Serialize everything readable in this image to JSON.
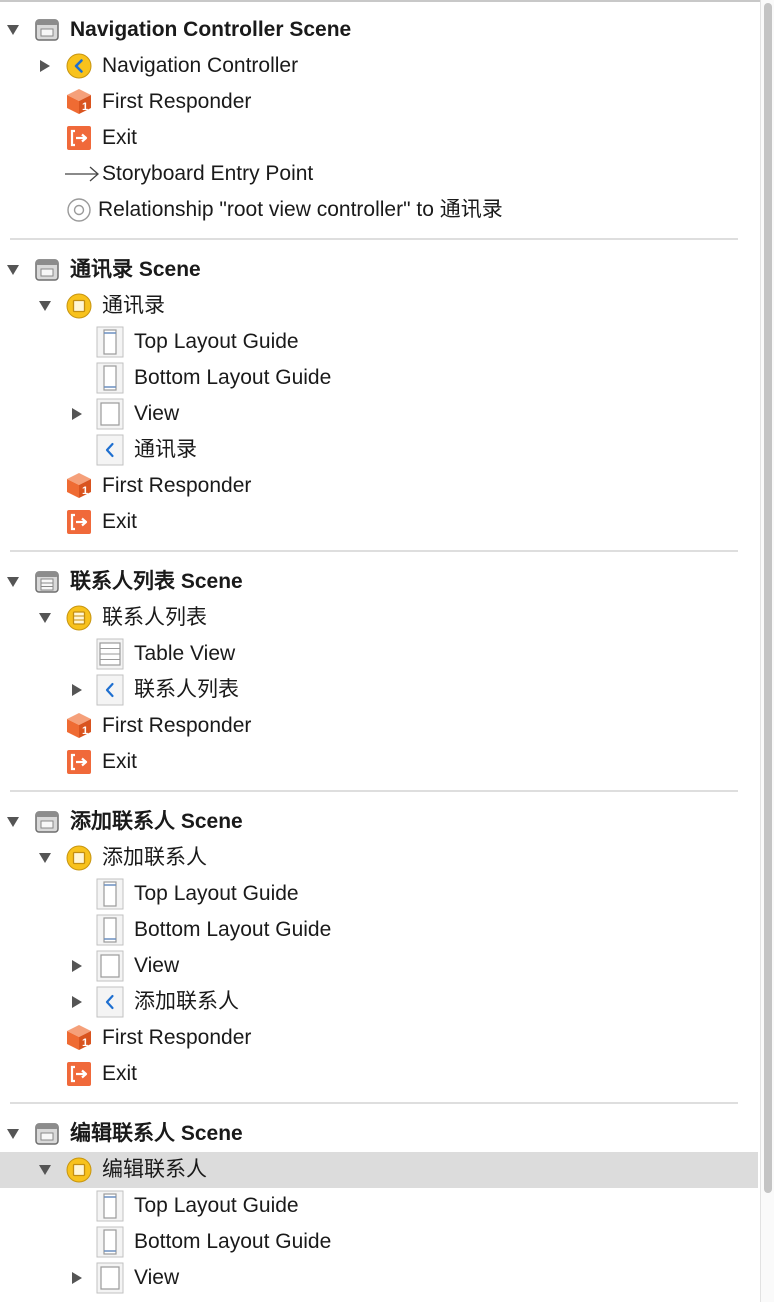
{
  "colors": {
    "selection": "#dcdcdc",
    "separator": "#dedede",
    "disclosure": "#555555",
    "controller_yellow": "#f8c21c",
    "responder_orange": "#ef6b33",
    "exit_orange": "#f0693a",
    "back_blue": "#1e6fd0"
  },
  "rows": [
    {
      "label": "Navigation Controller Scene",
      "icon": "scene-icon",
      "indent": 0,
      "disclosure": "expanded",
      "bold": true
    },
    {
      "label": "Navigation Controller",
      "icon": "navigation-controller-icon",
      "indent": 1,
      "disclosure": "collapsed"
    },
    {
      "label": "First Responder",
      "icon": "first-responder-icon",
      "indent": 1,
      "disclosure": "none"
    },
    {
      "label": "Exit",
      "icon": "exit-icon",
      "indent": 1,
      "disclosure": "none"
    },
    {
      "label": "Storyboard Entry Point",
      "icon": "arrow-icon",
      "indent": 1,
      "disclosure": "none"
    },
    {
      "label": "Relationship \"root view controller\" to 通讯录",
      "icon": "relationship-icon",
      "indent": 1,
      "disclosure": "none",
      "label_offset": -4
    },
    {
      "separator": true
    },
    {
      "label": "通讯录 Scene",
      "icon": "scene-icon",
      "indent": 0,
      "disclosure": "expanded",
      "bold": true
    },
    {
      "label": "通讯录",
      "icon": "view-controller-icon",
      "indent": 1,
      "disclosure": "expanded"
    },
    {
      "label": "Top Layout Guide",
      "icon": "top-layout-guide-icon",
      "indent": 2,
      "disclosure": "none"
    },
    {
      "label": "Bottom Layout Guide",
      "icon": "bottom-layout-guide-icon",
      "indent": 2,
      "disclosure": "none"
    },
    {
      "label": "View",
      "icon": "view-icon",
      "indent": 2,
      "disclosure": "collapsed"
    },
    {
      "label": "通讯录",
      "icon": "navigation-item-icon",
      "indent": 2,
      "disclosure": "none"
    },
    {
      "label": "First Responder",
      "icon": "first-responder-icon",
      "indent": 1,
      "disclosure": "none"
    },
    {
      "label": "Exit",
      "icon": "exit-icon",
      "indent": 1,
      "disclosure": "none"
    },
    {
      "separator": true
    },
    {
      "label": "联系人列表 Scene",
      "icon": "table-scene-icon",
      "indent": 0,
      "disclosure": "expanded",
      "bold": true
    },
    {
      "label": "联系人列表",
      "icon": "table-view-controller-icon",
      "indent": 1,
      "disclosure": "expanded"
    },
    {
      "label": "Table View",
      "icon": "table-view-icon",
      "indent": 2,
      "disclosure": "none"
    },
    {
      "label": "联系人列表",
      "icon": "navigation-item-icon",
      "indent": 2,
      "disclosure": "collapsed"
    },
    {
      "label": "First Responder",
      "icon": "first-responder-icon",
      "indent": 1,
      "disclosure": "none"
    },
    {
      "label": "Exit",
      "icon": "exit-icon",
      "indent": 1,
      "disclosure": "none"
    },
    {
      "separator": true
    },
    {
      "label": "添加联系人 Scene",
      "icon": "scene-icon",
      "indent": 0,
      "disclosure": "expanded",
      "bold": true
    },
    {
      "label": "添加联系人",
      "icon": "view-controller-icon",
      "indent": 1,
      "disclosure": "expanded"
    },
    {
      "label": "Top Layout Guide",
      "icon": "top-layout-guide-icon",
      "indent": 2,
      "disclosure": "none"
    },
    {
      "label": "Bottom Layout Guide",
      "icon": "bottom-layout-guide-icon",
      "indent": 2,
      "disclosure": "none"
    },
    {
      "label": "View",
      "icon": "view-icon",
      "indent": 2,
      "disclosure": "collapsed"
    },
    {
      "label": "添加联系人",
      "icon": "navigation-item-icon",
      "indent": 2,
      "disclosure": "collapsed"
    },
    {
      "label": "First Responder",
      "icon": "first-responder-icon",
      "indent": 1,
      "disclosure": "none"
    },
    {
      "label": "Exit",
      "icon": "exit-icon",
      "indent": 1,
      "disclosure": "none"
    },
    {
      "separator": true
    },
    {
      "label": "编辑联系人 Scene",
      "icon": "scene-icon",
      "indent": 0,
      "disclosure": "expanded",
      "bold": true
    },
    {
      "label": "编辑联系人",
      "icon": "view-controller-icon",
      "indent": 1,
      "disclosure": "expanded",
      "selected": true
    },
    {
      "label": "Top Layout Guide",
      "icon": "top-layout-guide-icon",
      "indent": 2,
      "disclosure": "none"
    },
    {
      "label": "Bottom Layout Guide",
      "icon": "bottom-layout-guide-icon",
      "indent": 2,
      "disclosure": "none"
    },
    {
      "label": "View",
      "icon": "view-icon",
      "indent": 2,
      "disclosure": "collapsed"
    }
  ]
}
